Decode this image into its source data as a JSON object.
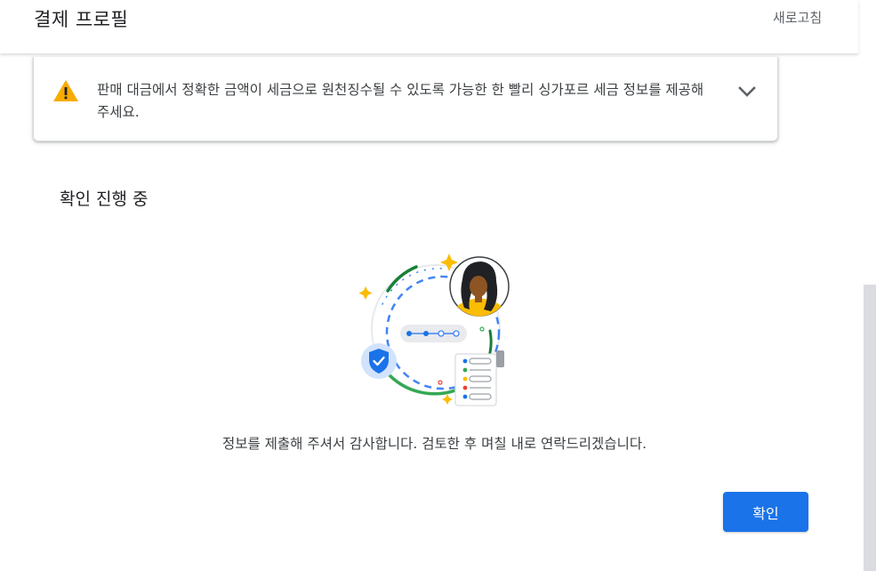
{
  "header": {
    "title": "결제 프로필",
    "refresh_label": "새로고침"
  },
  "warning": {
    "icon": "warning-triangle-icon",
    "message": "판매 대금에서 정확한 금액이 세금으로 원천징수될 수 있도록 가능한 한 빨리 싱가포르 세금 정보를 제공해 주세요.",
    "expand_icon": "chevron-down-icon"
  },
  "verification": {
    "title": "확인 진행 중",
    "message": "정보를 제출해 주셔서 감사합니다. 검토한 후 며칠 내로 연락드리겠습니다.",
    "confirm_label": "확인"
  },
  "colors": {
    "accent": "#1a73e8",
    "warning": "#f9ab00",
    "green": "#34a853",
    "dark_green": "#188038",
    "red": "#ea4335"
  }
}
